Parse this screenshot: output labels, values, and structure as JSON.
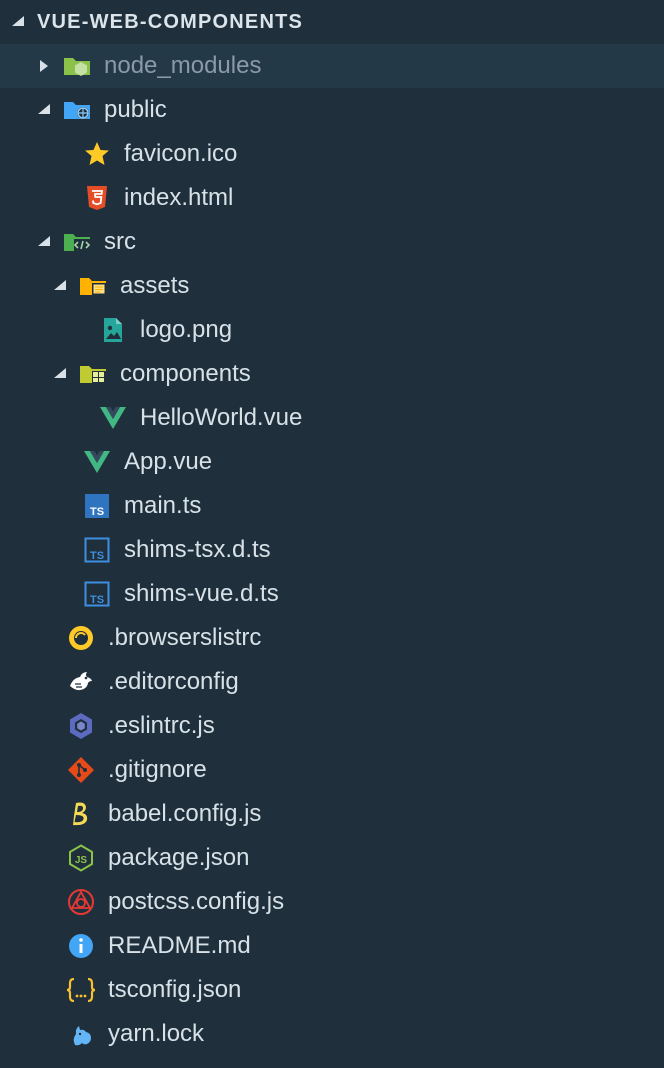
{
  "explorer": {
    "title": "VUE-WEB-COMPONENTS",
    "colors": {
      "background": "#1f2f3b",
      "selected_row": "#243948",
      "text": "#d7e1e7"
    },
    "items": [
      {
        "label": "node_modules",
        "type": "folder",
        "state": "collapsed",
        "icon": "node-folder-icon"
      },
      {
        "label": "public",
        "type": "folder",
        "state": "expanded",
        "icon": "public-folder-icon"
      },
      {
        "label": "favicon.ico",
        "type": "file",
        "icon": "star-icon"
      },
      {
        "label": "index.html",
        "type": "file",
        "icon": "html5-icon"
      },
      {
        "label": "src",
        "type": "folder",
        "state": "expanded",
        "icon": "src-folder-icon"
      },
      {
        "label": "assets",
        "type": "folder",
        "state": "expanded",
        "icon": "assets-folder-icon"
      },
      {
        "label": "logo.png",
        "type": "file",
        "icon": "image-icon"
      },
      {
        "label": "components",
        "type": "folder",
        "state": "expanded",
        "icon": "components-folder-icon"
      },
      {
        "label": "HelloWorld.vue",
        "type": "file",
        "icon": "vue-icon"
      },
      {
        "label": "App.vue",
        "type": "file",
        "icon": "vue-icon"
      },
      {
        "label": "main.ts",
        "type": "file",
        "icon": "typescript-icon"
      },
      {
        "label": "shims-tsx.d.ts",
        "type": "file",
        "icon": "typescript-def-icon"
      },
      {
        "label": "shims-vue.d.ts",
        "type": "file",
        "icon": "typescript-def-icon"
      },
      {
        "label": ".browserslistrc",
        "type": "file",
        "icon": "browserslist-icon"
      },
      {
        "label": ".editorconfig",
        "type": "file",
        "icon": "editorconfig-icon"
      },
      {
        "label": ".eslintrc.js",
        "type": "file",
        "icon": "eslint-icon"
      },
      {
        "label": ".gitignore",
        "type": "file",
        "icon": "git-icon"
      },
      {
        "label": "babel.config.js",
        "type": "file",
        "icon": "babel-icon"
      },
      {
        "label": "package.json",
        "type": "file",
        "icon": "nodejs-icon"
      },
      {
        "label": "postcss.config.js",
        "type": "file",
        "icon": "postcss-icon"
      },
      {
        "label": "README.md",
        "type": "file",
        "icon": "info-icon"
      },
      {
        "label": "tsconfig.json",
        "type": "file",
        "icon": "json-icon"
      },
      {
        "label": "yarn.lock",
        "type": "file",
        "icon": "yarn-icon"
      }
    ]
  }
}
